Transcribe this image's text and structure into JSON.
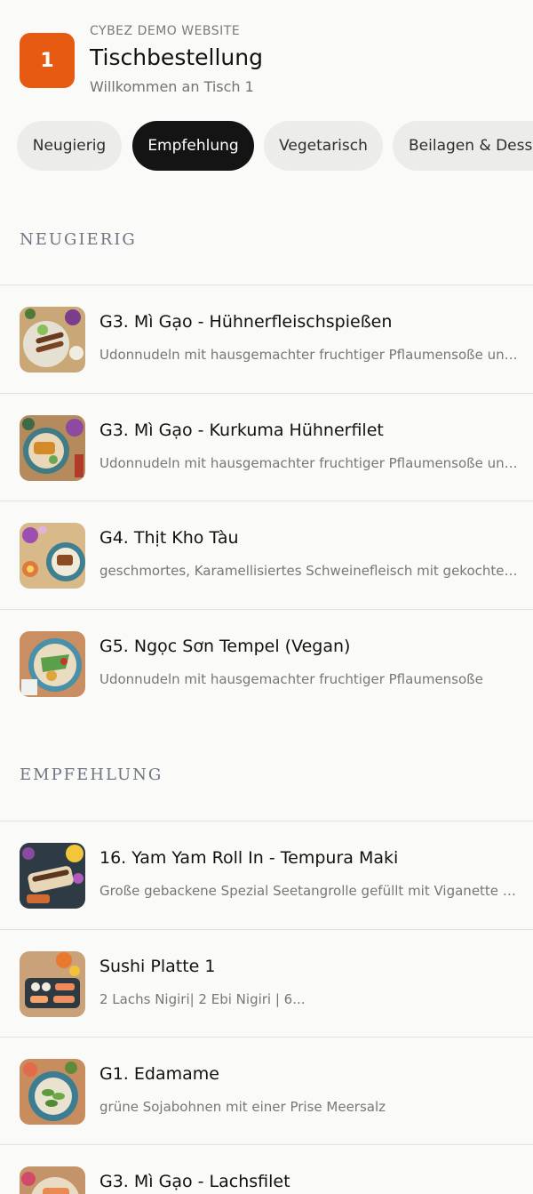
{
  "header": {
    "table_number": "1",
    "site_name": "CYBEZ DEMO WEBSITE",
    "title": "Tischbestellung",
    "welcome": "Willkommen an Tisch 1"
  },
  "tabs": [
    {
      "label": "Neugierig",
      "active": false
    },
    {
      "label": "Empfehlung",
      "active": true
    },
    {
      "label": "Vegetarisch",
      "active": false
    },
    {
      "label": "Beilagen & Desserts",
      "active": false
    }
  ],
  "sections": [
    {
      "title": "NEUGIERIG",
      "items": [
        {
          "title": "G3. Mì Gạo - Hühnerfleischspießen",
          "description": "Udonnudeln mit hausgemachter fruchtiger Pflaumensoße und gebratenen Hühnerfleischspießen"
        },
        {
          "title": "G3. Mì Gạo - Kurkuma Hühnerfilet",
          "description": "Udonnudeln mit hausgemachter fruchtiger Pflaumensoße und Kurkuma Hühnerfilet"
        },
        {
          "title": "G4. Thịt Kho Tàu",
          "description": "geschmortes, Karamellisiertes Schweinefleisch mit gekochtem Ei"
        },
        {
          "title": "G5. Ngọc Sơn Tempel (Vegan)",
          "description": "Udonnudeln mit hausgemachter fruchtiger Pflaumensoße"
        }
      ]
    },
    {
      "title": "EMPFEHLUNG",
      "items": [
        {
          "title": "16. Yam Yam Roll In - Tempura Maki",
          "description": "Große gebackene Spezial Seetangrolle gefüllt mit Viganette Rolle"
        },
        {
          "title": "Sushi Platte 1",
          "description": "2 Lachs Nigiri| 2 Ebi Nigiri | 6..."
        },
        {
          "title": "G1. Edamame",
          "description": "grüne Sojabohnen mit einer Prise Meersalz"
        },
        {
          "title": "G3. Mì Gạo - Lachsfilet",
          "description": ""
        }
      ]
    }
  ]
}
